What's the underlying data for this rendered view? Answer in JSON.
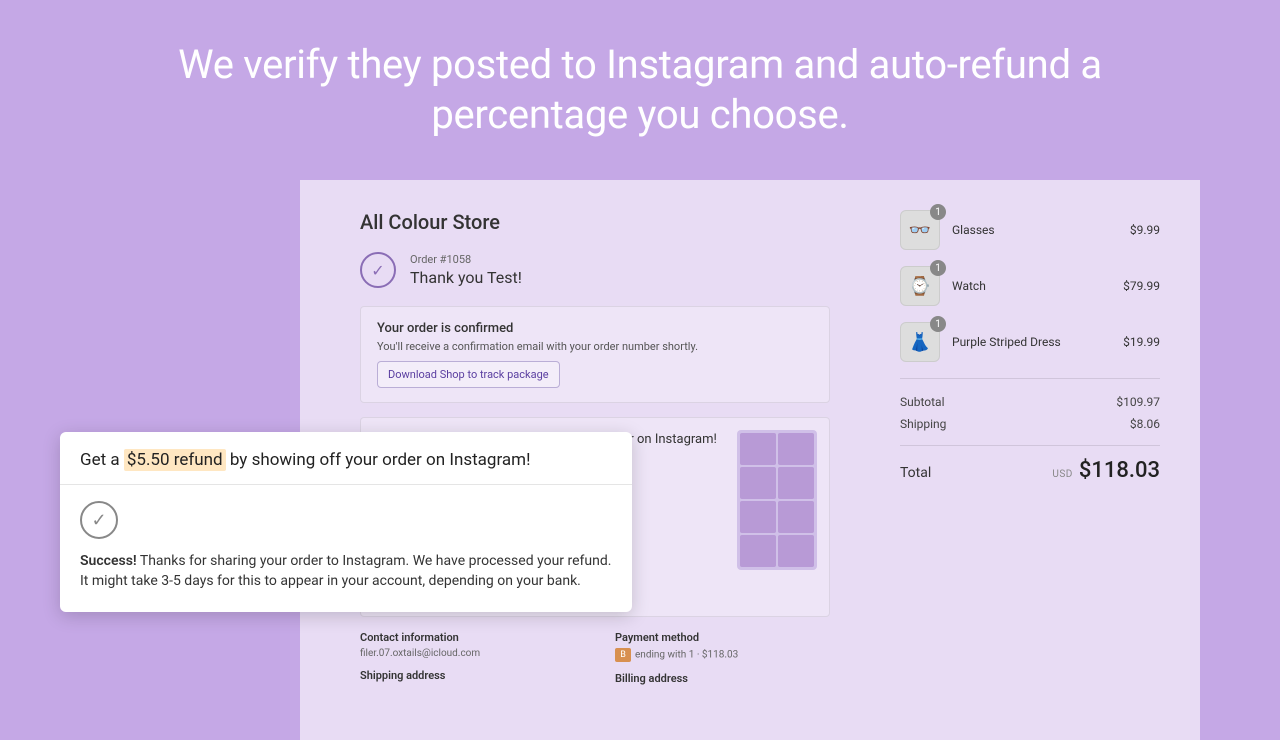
{
  "hero": "We verify they posted to Instagram and auto-refund a percentage you choose.",
  "store": {
    "name": "All Colour Store"
  },
  "order": {
    "number_label": "Order #1058",
    "thank": "Thank you Test!"
  },
  "confirm": {
    "title": "Your order is confirmed",
    "body": "You'll receive a confirmation email with your order number shortly.",
    "download": "Download Shop to track package"
  },
  "promo_behind": {
    "title": "Get a  $5.50 refund  by showing off your order on Instagram!"
  },
  "contact": {
    "h": "Contact information",
    "email": "filer.07.oxtails@icloud.com",
    "ship_h": "Shipping address"
  },
  "payment": {
    "h": "Payment method",
    "text": "ending with 1 · $118.03",
    "bill_h": "Billing address"
  },
  "items": [
    {
      "name": "Glasses",
      "price": "$9.99",
      "qty": "1",
      "icon": "👓"
    },
    {
      "name": "Watch",
      "price": "$79.99",
      "qty": "1",
      "icon": "⌚"
    },
    {
      "name": "Purple Striped Dress",
      "price": "$19.99",
      "qty": "1",
      "icon": "👗"
    }
  ],
  "summary": {
    "subtotal_l": "Subtotal",
    "subtotal_v": "$109.97",
    "shipping_l": "Shipping",
    "shipping_v": "$8.06",
    "total_l": "Total",
    "currency": "USD",
    "total_v": "$118.03"
  },
  "popout": {
    "title_pre": "Get a ",
    "title_hi": "$5.50 refund",
    "title_post": " by showing off your order on Instagram!",
    "success_label": "Success!",
    "success_body": " Thanks for sharing your order to Instagram. We have processed your refund. It might take 3-5 days for this to appear in your account, depending on your bank."
  }
}
